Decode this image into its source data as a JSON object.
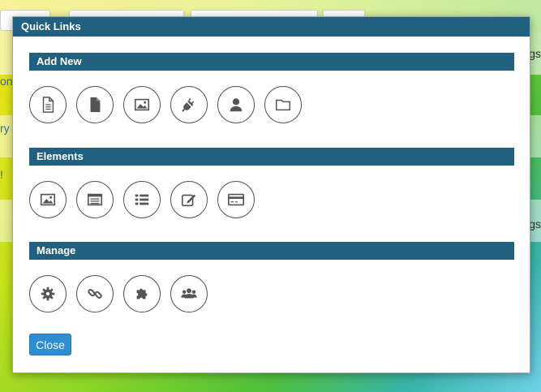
{
  "background": {
    "right_text_1": "gs",
    "right_text_2": "gs",
    "left_text_1": "on",
    "left_text_2": "ry",
    "left_text_3": "!"
  },
  "modal": {
    "title": "Quick Links",
    "close_label": "Close"
  },
  "sections": [
    {
      "title": "Add New",
      "icons": [
        "new-article-icon",
        "new-page-icon",
        "new-image-icon",
        "new-plugin-icon",
        "new-user-icon",
        "new-folder-icon"
      ]
    },
    {
      "title": "Elements",
      "icons": [
        "images-icon",
        "browser-window-icon",
        "list-icon",
        "form-edit-icon",
        "credit-card-icon"
      ]
    },
    {
      "title": "Manage",
      "icons": [
        "settings-gear-icon",
        "link-icon",
        "puzzle-piece-icon",
        "users-group-icon"
      ]
    }
  ],
  "colors": {
    "header": "#21607f",
    "close_button": "#2f8ed1"
  }
}
